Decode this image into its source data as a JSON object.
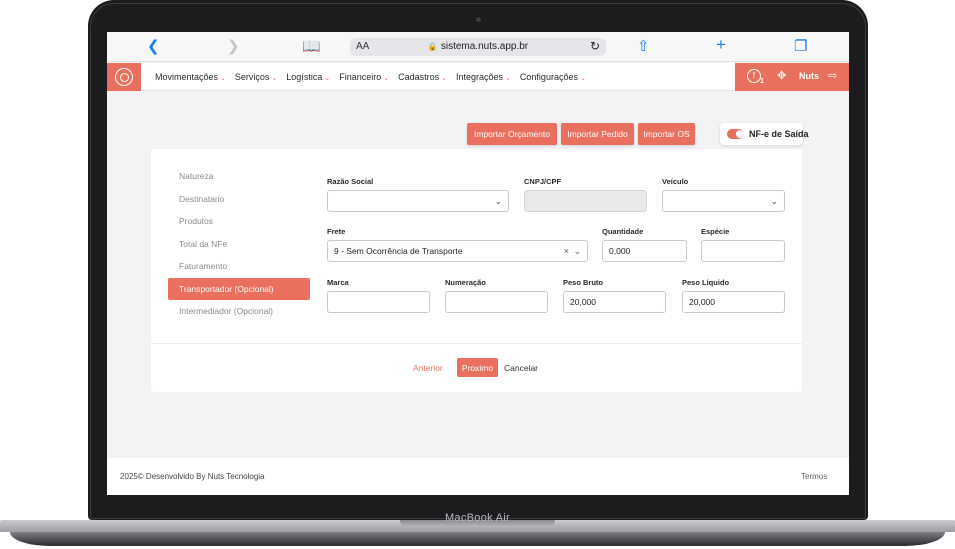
{
  "device": {
    "brand_label": "MacBook Air"
  },
  "browser": {
    "text_size_label": "AA",
    "url": "sistema.nuts.app.br",
    "icons": [
      "back-icon",
      "forward-icon",
      "bookmarks-icon",
      "reload-icon",
      "share-icon",
      "new-tab-icon",
      "tabs-icon"
    ]
  },
  "nav": {
    "items": [
      {
        "label": "Movimentações"
      },
      {
        "label": "Serviços"
      },
      {
        "label": "Logística"
      },
      {
        "label": "Financeiro"
      },
      {
        "label": "Cadastros"
      },
      {
        "label": "Integrações"
      },
      {
        "label": "Configurações"
      }
    ],
    "notification_count": "1",
    "user_label": "Nuts"
  },
  "actions": {
    "import_quote": "Importar Orçamento",
    "import_order": "Importar Pedido",
    "import_os": "Importar OS",
    "toggle_label": "NF-e de Saída",
    "toggle_on": true
  },
  "steps": [
    {
      "label": "Natureza"
    },
    {
      "label": "Destinatario"
    },
    {
      "label": "Produtos"
    },
    {
      "label": "Total da NFe"
    },
    {
      "label": "Faturamento"
    },
    {
      "label": "Transportador (Opcional)",
      "active": true
    },
    {
      "label": "Intermediador (Opcional)"
    }
  ],
  "form": {
    "razao_social": {
      "label": "Razão Social",
      "value": ""
    },
    "cnpj_cpf": {
      "label": "CNPJ/CPF",
      "value": ""
    },
    "veiculo": {
      "label": "Veículo",
      "value": ""
    },
    "frete": {
      "label": "Frete",
      "value": "9 - Sem Ocorrência de Transporte"
    },
    "quantidade": {
      "label": "Quantidade",
      "value": "0,000"
    },
    "especie": {
      "label": "Espécie",
      "value": ""
    },
    "marca": {
      "label": "Marca",
      "value": ""
    },
    "numeracao": {
      "label": "Numeração",
      "value": ""
    },
    "peso_bruto": {
      "label": "Peso Bruto",
      "value": "20,000"
    },
    "peso_liquido": {
      "label": "Peso Líquido",
      "value": "20,000"
    }
  },
  "footer_nav": {
    "previous": "Anterior",
    "next": "Proximo",
    "cancel": "Cancelar"
  },
  "footer": {
    "copyright": "2025© Desenvolvido By Nuts Tecnologia",
    "terms": "Termos"
  },
  "colors": {
    "accent": "#e9705f",
    "background": "#f3f3f6"
  }
}
